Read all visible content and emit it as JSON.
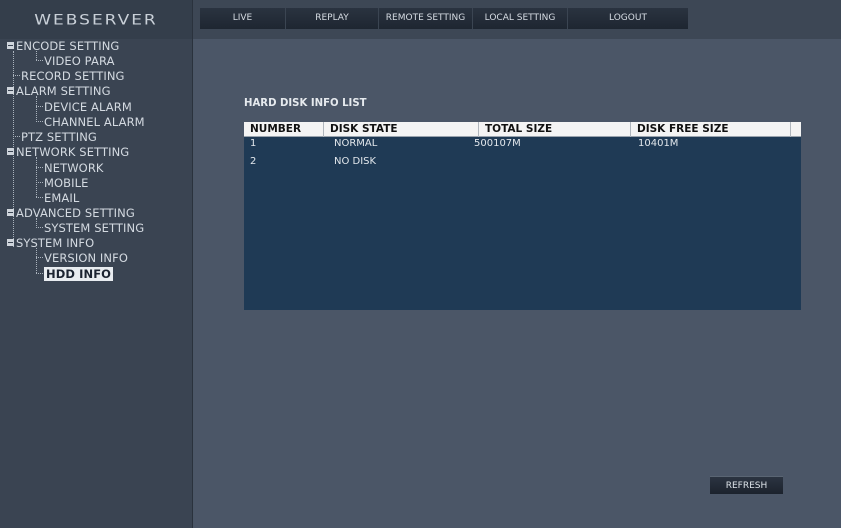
{
  "app": {
    "logo": "WEBSERVER"
  },
  "menu": [
    {
      "label": "LIVE"
    },
    {
      "label": "REPLAY"
    },
    {
      "label": "REMOTE SETTING"
    },
    {
      "label": "LOCAL SETTING"
    },
    {
      "label": "LOGOUT"
    }
  ],
  "sidebar": {
    "items": [
      {
        "label": "ENCODE SETTING"
      },
      {
        "label": "VIDEO PARA"
      },
      {
        "label": "RECORD SETTING"
      },
      {
        "label": "ALARM SETTING"
      },
      {
        "label": "DEVICE ALARM"
      },
      {
        "label": "CHANNEL ALARM"
      },
      {
        "label": "PTZ SETTING"
      },
      {
        "label": "NETWORK SETTING"
      },
      {
        "label": "NETWORK"
      },
      {
        "label": "MOBILE"
      },
      {
        "label": "EMAIL"
      },
      {
        "label": "ADVANCED SETTING"
      },
      {
        "label": "SYSTEM SETTING"
      },
      {
        "label": "SYSTEM INFO"
      },
      {
        "label": "VERSION INFO"
      },
      {
        "label": "HDD INFO"
      }
    ],
    "selected": "HDD INFO"
  },
  "main": {
    "title": "HARD DISK INFO LIST",
    "columns": [
      "NUMBER",
      "DISK STATE",
      "TOTAL SIZE",
      "DISK FREE SIZE"
    ],
    "rows": [
      [
        "1",
        "NORMAL",
        "500107M",
        "10401M"
      ],
      [
        "2",
        "NO DISK",
        "",
        ""
      ]
    ],
    "refresh_label": "REFRESH"
  },
  "colors": {
    "panel_bg": "#4b5667",
    "table_bg": "#1f3a55",
    "sidebar_bg": "#3a4452"
  }
}
